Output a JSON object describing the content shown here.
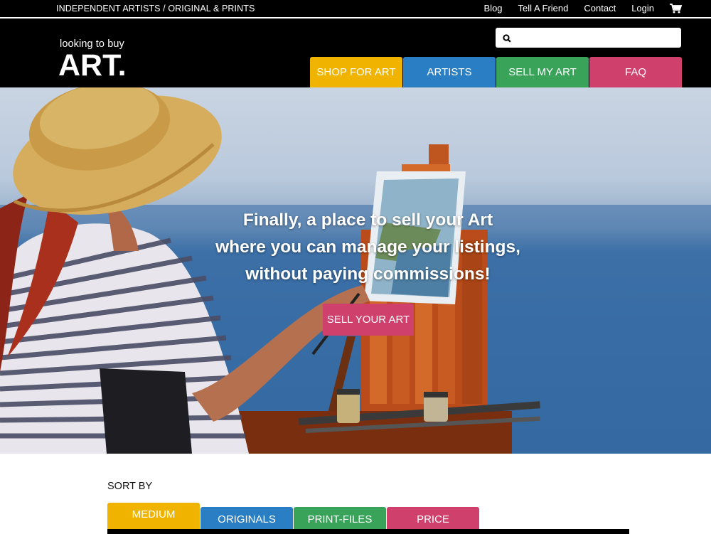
{
  "topbar": {
    "tagline": "INDEPENDENT ARTISTS / ORIGINAL & PRINTS",
    "links": [
      "Blog",
      "Tell A Friend",
      "Contact",
      "Login"
    ],
    "cart_icon": "shopping-cart-icon"
  },
  "logo": {
    "small": "looking to buy",
    "big": "ART."
  },
  "search": {
    "value": "",
    "placeholder": "",
    "icon": "search-icon"
  },
  "nav": {
    "tabs": [
      {
        "label": "SHOP FOR ART",
        "color": "#f0b400"
      },
      {
        "label": "ARTISTS",
        "color": "#2a7fc4"
      },
      {
        "label": "SELL MY ART",
        "color": "#3aa35a"
      },
      {
        "label": "FAQ",
        "color": "#d0406d"
      }
    ]
  },
  "hero": {
    "line1": "Finally, a place to sell your Art",
    "line2": "where you can manage your listings,",
    "line3": "without paying commissions!",
    "cta": "SELL YOUR ART",
    "cta_color": "#d0406d"
  },
  "sort": {
    "label": "SORT BY",
    "tabs": [
      {
        "label": "MEDIUM",
        "color": "#f0b400",
        "active": true
      },
      {
        "label": "ORIGINALS",
        "color": "#2a7fc4",
        "active": false
      },
      {
        "label": "PRINT-FILES",
        "color": "#3aa35a",
        "active": false
      },
      {
        "label": "PRICE",
        "color": "#d0406d",
        "active": false
      }
    ]
  }
}
